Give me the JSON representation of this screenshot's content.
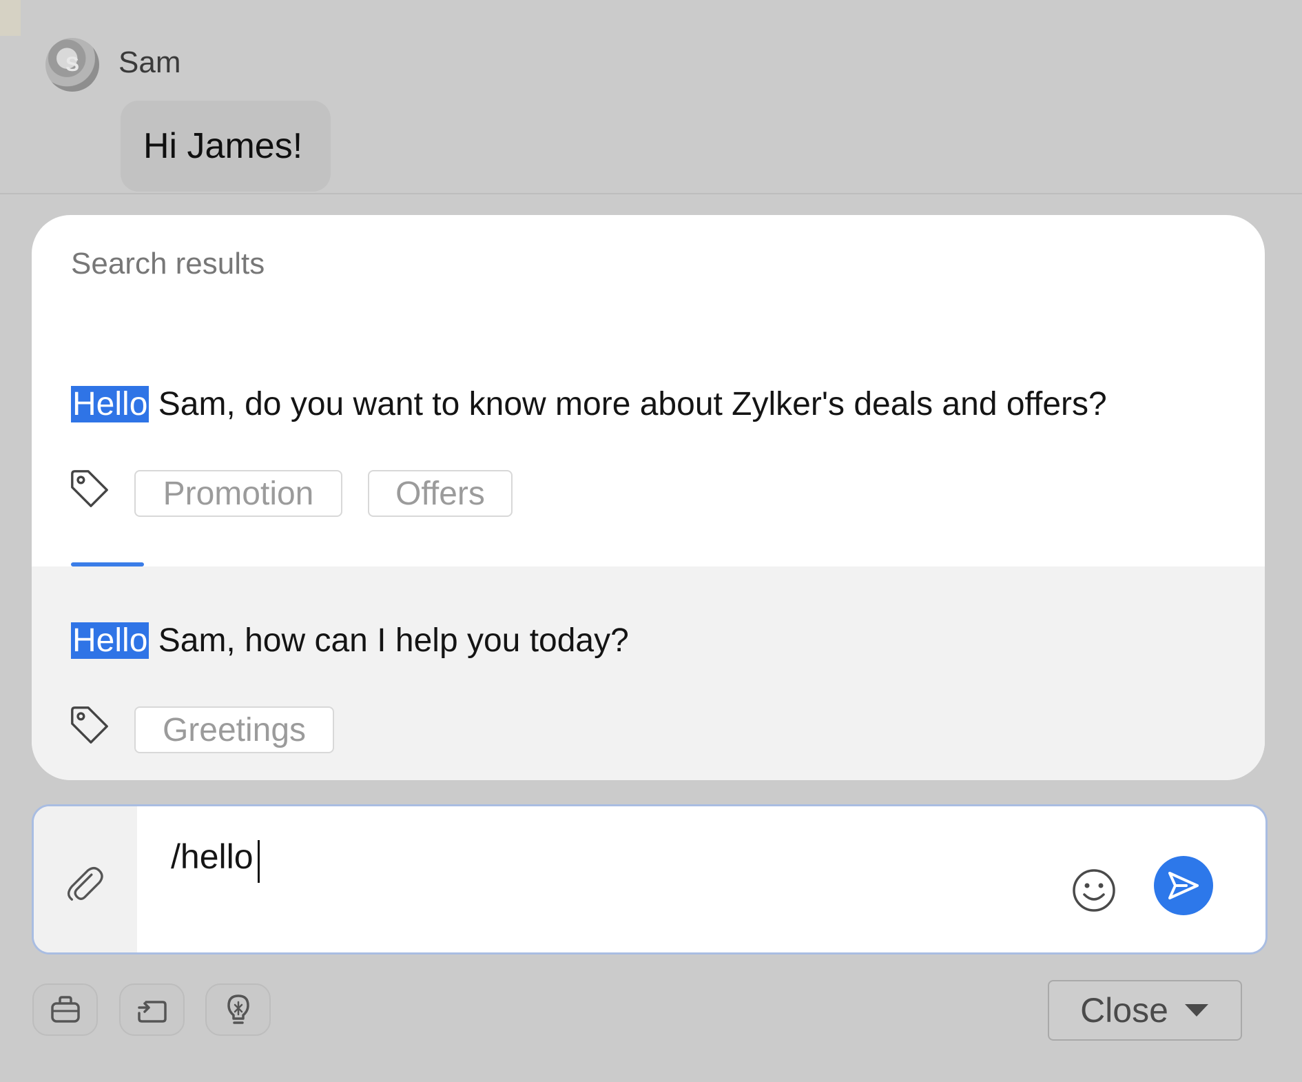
{
  "conversation": {
    "sender_name": "Sam",
    "avatar_initial": "S",
    "message": "Hi James!"
  },
  "search_results": {
    "heading": "Search results",
    "items": [
      {
        "highlight": "Hello",
        "text": " Sam, do you want to know more about Zylker's deals and offers?",
        "tags": [
          "Promotion",
          "Offers"
        ]
      },
      {
        "highlight": "Hello",
        "text": " Sam, how can I help you today?",
        "tags": [
          "Greetings"
        ]
      }
    ]
  },
  "composer": {
    "value": "/hello"
  },
  "toolbar": {
    "close_label": "Close"
  },
  "colors": {
    "accent": "#2d78ea",
    "highlight": "#2f74e6",
    "backdrop": "#cbcbcb"
  },
  "icons": {
    "attach": "paperclip-icon",
    "emoji": "smiley-icon",
    "send": "send-icon",
    "tag": "tag-icon",
    "tool_1": "briefcase-icon",
    "tool_2": "transfer-icon",
    "tool_3": "lightbulb-icon",
    "dropdown": "caret-down-icon"
  }
}
